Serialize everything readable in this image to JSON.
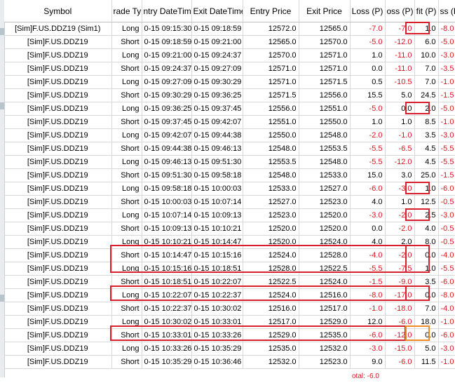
{
  "columns": [
    "Symbol",
    "rade Typ",
    "ntry DateTim",
    "Exit DateTime",
    "Entry Price",
    "Exit Price",
    "Loss (P)",
    "oss (P)",
    "fit (P)",
    "ss (P)"
  ],
  "trades": [
    [
      "[Sim]F.US.DDZ19 (Sim1)",
      "Long",
      "0-15  09:15:30",
      "0-15  09:18:59",
      "12572.0",
      "12565.0",
      "-7.0",
      "-7.0",
      "1.0",
      "-8.0"
    ],
    [
      "[Sim]F.US.DDZ19",
      "Short",
      "0-15  09:18:59",
      "0-15  09:21:00",
      "12565.0",
      "12570.0",
      "-5.0",
      "-12.0",
      "6.0",
      "-5.0"
    ],
    [
      "[Sim]F.US.DDZ19",
      "Long",
      "0-15  09:21:00",
      "0-15  09:24:37",
      "12570.0",
      "12571.0",
      "1.0",
      "-11.0",
      "10.0",
      "-3.0"
    ],
    [
      "[Sim]F.US.DDZ19",
      "Short",
      "0-15  09:24:37",
      "0-15  09:27:09",
      "12571.0",
      "12571.0",
      "0.0",
      "-11.0",
      "7.0",
      "-3.5"
    ],
    [
      "[Sim]F.US.DDZ19",
      "Long",
      "0-15  09:27:09",
      "0-15  09:30:29",
      "12571.0",
      "12571.5",
      "0.5",
      "-10.5",
      "7.0",
      "-1.0"
    ],
    [
      "[Sim]F.US.DDZ19",
      "Short",
      "0-15  09:30:29",
      "0-15  09:36:25",
      "12571.5",
      "12556.0",
      "15.5",
      "5.0",
      "24.5",
      "-1.5"
    ],
    [
      "[Sim]F.US.DDZ19",
      "Long",
      "0-15  09:36:25",
      "0-15  09:37:45",
      "12556.0",
      "12551.0",
      "-5.0",
      "0.0",
      "2.0",
      "-5.0"
    ],
    [
      "[Sim]F.US.DDZ19",
      "Short",
      "0-15  09:37:45",
      "0-15  09:42:07",
      "12551.0",
      "12550.0",
      "1.0",
      "1.0",
      "8.5",
      "-1.0"
    ],
    [
      "[Sim]F.US.DDZ19",
      "Long",
      "0-15  09:42:07",
      "0-15  09:44:38",
      "12550.0",
      "12548.0",
      "-2.0",
      "-1.0",
      "3.5",
      "-3.0"
    ],
    [
      "[Sim]F.US.DDZ19",
      "Short",
      "0-15  09:44:38",
      "0-15  09:46:13",
      "12548.0",
      "12553.5",
      "-5.5",
      "-6.5",
      "4.5",
      "-5.5"
    ],
    [
      "[Sim]F.US.DDZ19",
      "Long",
      "0-15  09:46:13",
      "0-15  09:51:30",
      "12553.5",
      "12548.0",
      "-5.5",
      "-12.0",
      "4.5",
      "-5.5"
    ],
    [
      "[Sim]F.US.DDZ19",
      "Short",
      "0-15  09:51:30",
      "0-15  09:58:18",
      "12548.0",
      "12533.0",
      "15.0",
      "3.0",
      "25.0",
      "-1.5"
    ],
    [
      "[Sim]F.US.DDZ19",
      "Long",
      "0-15  09:58:18",
      "0-15  10:00:03",
      "12533.0",
      "12527.0",
      "-6.0",
      "-3.0",
      "1.0",
      "-6.0"
    ],
    [
      "[Sim]F.US.DDZ19",
      "Short",
      "0-15  10:00:03",
      "0-15  10:07:14",
      "12527.0",
      "12523.0",
      "4.0",
      "1.0",
      "12.5",
      "-0.5"
    ],
    [
      "[Sim]F.US.DDZ19",
      "Long",
      "0-15  10:07:14",
      "0-15  10:09:13",
      "12523.0",
      "12520.0",
      "-3.0",
      "-2.0",
      "2.5",
      "-3.0"
    ],
    [
      "[Sim]F.US.DDZ19",
      "Short",
      "0-15  10:09:13",
      "0-15  10:10:21",
      "12520.0",
      "12520.0",
      "0.0",
      "-2.0",
      "4.0",
      "-0.5"
    ],
    [
      "[Sim]F.US.DDZ19",
      "Long",
      "0-15  10:10:21",
      "0-15  10:14:47",
      "12520.0",
      "12524.0",
      "4.0",
      "2.0",
      "8.0",
      "-0.5"
    ],
    [
      "[Sim]F.US.DDZ19",
      "Short",
      "0-15  10:14:47",
      "0-15  10:15:16",
      "12524.0",
      "12528.0",
      "-4.0",
      "-2.0",
      "0.0",
      "-4.0"
    ],
    [
      "[Sim]F.US.DDZ19",
      "Long",
      "0-15  10:15:16",
      "0-15  10:18:51",
      "12528.0",
      "12522.5",
      "-5.5",
      "-7.5",
      "1.0",
      "-5.5"
    ],
    [
      "[Sim]F.US.DDZ19",
      "Short",
      "0-15  10:18:51",
      "0-15  10:22:07",
      "12522.5",
      "12524.0",
      "-1.5",
      "-9.0",
      "3.5",
      "-6.0"
    ],
    [
      "[Sim]F.US.DDZ19",
      "Long",
      "0-15  10:22:07",
      "0-15  10:22:37",
      "12524.0",
      "12516.0",
      "-8.0",
      "-17.0",
      "0.0",
      "-8.0"
    ],
    [
      "[Sim]F.US.DDZ19",
      "Short",
      "0-15  10:22:37",
      "0-15  10:30:02",
      "12516.0",
      "12517.0",
      "-1.0",
      "-18.0",
      "7.0",
      "-4.0"
    ],
    [
      "[Sim]F.US.DDZ19",
      "Long",
      "0-15  10:30:02",
      "0-15  10:33:01",
      "12517.0",
      "12529.0",
      "12.0",
      "-6.0",
      "18.0",
      "-1.0"
    ],
    [
      "[Sim]F.US.DDZ19",
      "Short",
      "0-15  10:33:01",
      "0-15  10:33:26",
      "12529.0",
      "12535.0",
      "-6.0",
      "-12.0",
      "0.0",
      "-6.0"
    ],
    [
      "[Sim]F.US.DDZ19",
      "Long",
      "0-15  10:33:26",
      "0-15  10:35:29",
      "12535.0",
      "12532.0",
      "-3.0",
      "-15.0",
      "5.0",
      "-3.0"
    ],
    [
      "[Sim]F.US.DDZ19",
      "Short",
      "0-15  10:35:29",
      "0-15  10:36:46",
      "12532.0",
      "12523.0",
      "9.0",
      "-6.0",
      "11.5",
      "-1.0"
    ]
  ],
  "total_label": "otal: -6.0",
  "colors": {
    "negative": "#e0141e",
    "highlight_red": "#d7202b",
    "highlight_orange": "#f08a24"
  }
}
